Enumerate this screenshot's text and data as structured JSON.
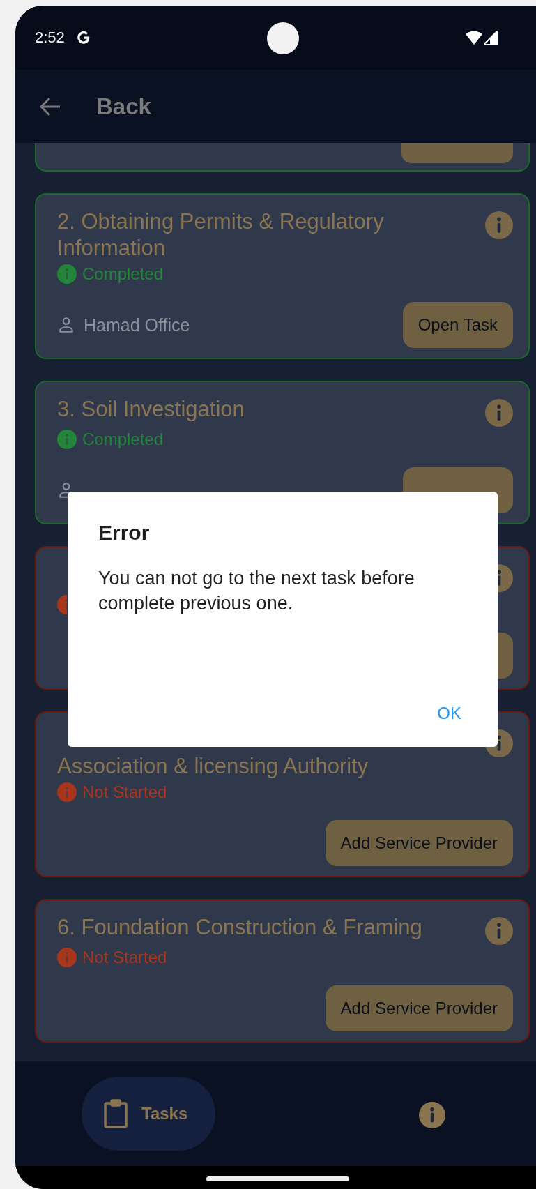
{
  "status_bar": {
    "time": "2:52"
  },
  "app_bar": {
    "back_label": "Back"
  },
  "tasks": [
    {
      "kind": "clipped",
      "completed": true
    },
    {
      "kind": "full",
      "title": "2. Obtaining Permits & Regulatory Information",
      "completed": true,
      "status_label": "Completed",
      "assignee": "Hamad Office",
      "action_label": "Open Task"
    },
    {
      "kind": "full",
      "title": "3. Soil Investigation",
      "completed": true,
      "status_label": "Completed"
    },
    {
      "kind": "full",
      "completed": false
    },
    {
      "kind": "covered_top",
      "title": "Association & licensing Authority",
      "completed": false,
      "status_label": "Not Started",
      "action_label": "Add Service Provider"
    },
    {
      "kind": "full",
      "title": "6. Foundation Construction & Framing",
      "completed": false,
      "status_label": "Not Started",
      "action_label": "Add Service Provider"
    }
  ],
  "bottom_nav": [
    {
      "label": "Tasks",
      "selected": true
    },
    {
      "selected": false
    }
  ],
  "dialog": {
    "title": "Error",
    "message": "You can not go to the next task before complete previous one.",
    "buttons": [
      "OK"
    ]
  }
}
